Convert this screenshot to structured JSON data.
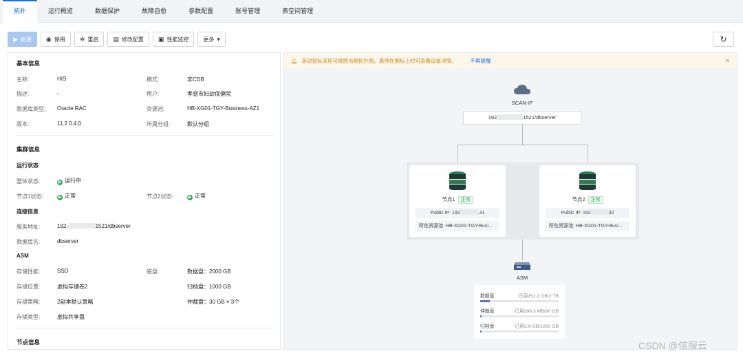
{
  "tabs": [
    "拓扑",
    "运行概览",
    "数据保护",
    "故障自愈",
    "参数配置",
    "账号管理",
    "表空间管理"
  ],
  "toolbar": {
    "start": "启用",
    "stop": "停用",
    "restart": "重启",
    "modify": "修改配置",
    "monitor": "性能监控",
    "more": "更多"
  },
  "basic": {
    "title": "基本信息",
    "name_label": "名称:",
    "name": "HIS",
    "mode_label": "模式:",
    "mode": "非CDB",
    "desc_label": "描述:",
    "desc": "-",
    "user_label": "用户:",
    "user": "孝感市妇幼保健院",
    "dbtype_label": "数据库类型:",
    "dbtype": "Oracle RAC",
    "pool_label": "资源池:",
    "pool": "HB-XG01-TGY-Business-AZ1",
    "version_label": "版本:",
    "version": "11.2.0.4.0",
    "group_label": "所属分组:",
    "group": "默认分组"
  },
  "cluster": {
    "title": "集群信息",
    "run_title": "运行状态",
    "overall_label": "整体状态:",
    "overall": "运行中",
    "node1_label": "节点1状态:",
    "node1": "正常",
    "node2_label": "节点2状态:",
    "node2": "正常",
    "conn_title": "连接信息",
    "addr_label": "服务地址:",
    "addr_prefix": "192.",
    "addr_suffix": "1521/dbserver",
    "dbname_label": "数据库名:",
    "dbname": "dbserver",
    "asm_title": "ASM",
    "perf_label": "存储性能:",
    "perf": "SSD",
    "disk_label": "磁盘:",
    "disk_data": "数据盘：2000 GB",
    "loc_label": "存储位置:",
    "loc": "虚拟存储卷2",
    "archive": "归档盘：1000 GB",
    "policy_label": "存储策略:",
    "policy": "2副本默认策略",
    "arb": "仲裁盘：30 GB × 3个",
    "stype_label": "存储类型:",
    "stype": "虚拟共享盘"
  },
  "node_info_title": "节点信息",
  "topology": {
    "notice": "滚动鼠标滚轮可缩放当前拓扑图。悬停在图标上时可查看设备详情。",
    "notice_link": "不再提醒",
    "scan_label": "SCAN-IP",
    "scan_prefix": "192.",
    "scan_suffix": "1521/dbserver",
    "node1_name": "节点1",
    "node2_name": "节点2",
    "status": "正常",
    "node1_ip_prefix": "Public IP: 192",
    "node1_ip_suffix": ".31",
    "node2_ip_prefix": "Public IP: 192",
    "node2_ip_suffix": "32",
    "pool_text": "所在资源池: HB-XG01-TGY-Busi...",
    "asm_label": "ASM",
    "disks": [
      {
        "name": "数据盘",
        "usage": "已用251.2 GB/2 TB",
        "fraction": 0.123
      },
      {
        "name": "仲裁盘",
        "usage": "已用396.3 MB/90 GB",
        "fraction": 0.004
      },
      {
        "name": "归档盘",
        "usage": "已用2.6 GB/1000 GB",
        "fraction": 0.003
      }
    ]
  },
  "watermark": "CSDN @信服云"
}
